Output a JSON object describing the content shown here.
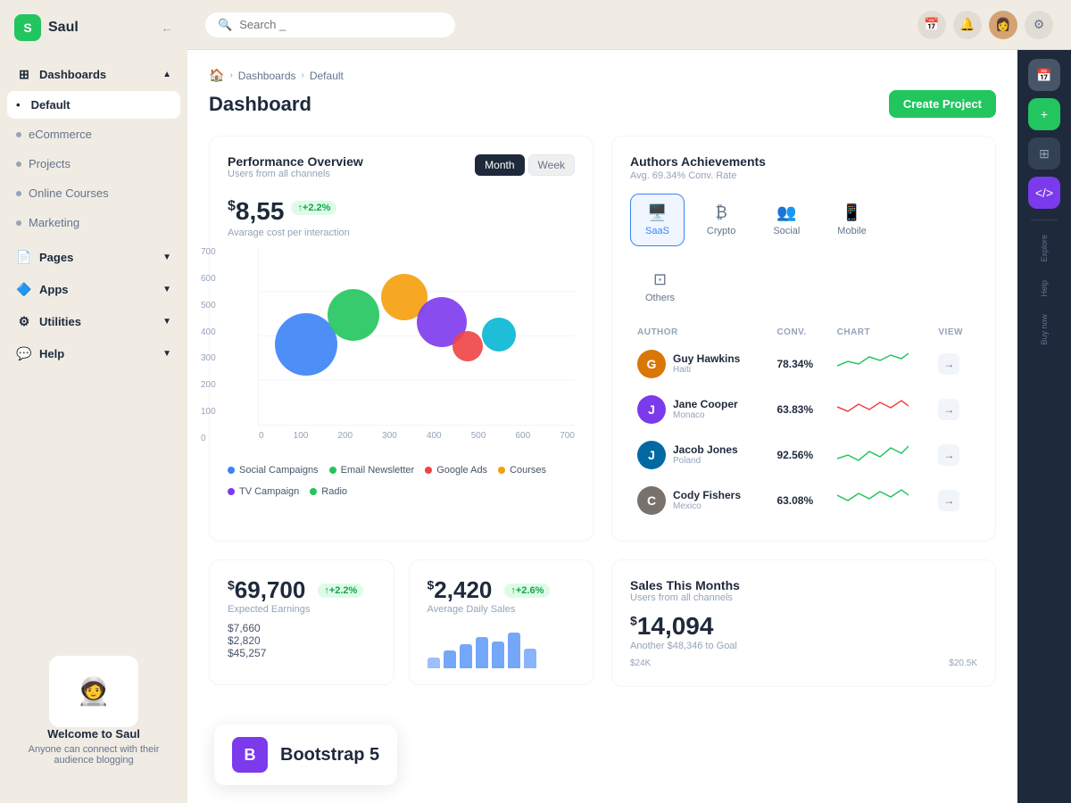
{
  "brand": {
    "icon": "S",
    "name": "Saul",
    "arrow": "←"
  },
  "search": {
    "placeholder": "Search _"
  },
  "sidebar": {
    "items": [
      {
        "id": "dashboards",
        "label": "Dashboards",
        "icon": "⊞",
        "hasChevron": true,
        "isHeader": true
      },
      {
        "id": "default",
        "label": "Default",
        "isActive": true
      },
      {
        "id": "ecommerce",
        "label": "eCommerce"
      },
      {
        "id": "projects",
        "label": "Projects"
      },
      {
        "id": "online-courses",
        "label": "Online Courses"
      },
      {
        "id": "marketing",
        "label": "Marketing"
      },
      {
        "id": "pages",
        "label": "Pages",
        "icon": "📄",
        "hasChevron": true,
        "isHeader": true
      },
      {
        "id": "apps",
        "label": "Apps",
        "icon": "🔷",
        "hasChevron": true,
        "isHeader": true
      },
      {
        "id": "utilities",
        "label": "Utilities",
        "icon": "⚙",
        "hasChevron": true,
        "isHeader": true
      },
      {
        "id": "help",
        "label": "Help",
        "icon": "💬",
        "hasChevron": true,
        "isHeader": true
      }
    ]
  },
  "sidebar_bottom": {
    "title": "Welcome to Saul",
    "subtitle": "Anyone can connect with their audience blogging",
    "emoji": "🧑‍🚀"
  },
  "breadcrumb": {
    "home": "🏠",
    "dashboards": "Dashboards",
    "current": "Default"
  },
  "page_title": "Dashboard",
  "create_btn": "Create Project",
  "performance": {
    "title": "Performance Overview",
    "subtitle": "Users from all channels",
    "tab_month": "Month",
    "tab_week": "Week",
    "value": "8,55",
    "currency": "$",
    "badge": "+2.2%",
    "label": "Avarage cost per interaction",
    "y_axis": [
      "700",
      "600",
      "500",
      "400",
      "300",
      "200",
      "100",
      "0"
    ],
    "x_axis": [
      "0",
      "100",
      "200",
      "300",
      "400",
      "500",
      "600",
      "700"
    ],
    "bubbles": [
      {
        "x": 18,
        "y": 48,
        "size": 70,
        "color": "#3b82f6"
      },
      {
        "x": 32,
        "y": 30,
        "size": 60,
        "color": "#22c55e"
      },
      {
        "x": 47,
        "y": 22,
        "size": 52,
        "color": "#f59e0b"
      },
      {
        "x": 58,
        "y": 35,
        "size": 55,
        "color": "#7c3aed"
      },
      {
        "x": 64,
        "y": 48,
        "size": 32,
        "color": "#ef4444"
      },
      {
        "x": 74,
        "y": 42,
        "size": 38,
        "color": "#06b6d4"
      }
    ],
    "legend": [
      {
        "label": "Social Campaigns",
        "color": "#3b82f6"
      },
      {
        "label": "Email Newsletter",
        "color": "#22c55e"
      },
      {
        "label": "Google Ads",
        "color": "#ef4444"
      },
      {
        "label": "Courses",
        "color": "#f59e0b"
      },
      {
        "label": "TV Campaign",
        "color": "#7c3aed"
      },
      {
        "label": "Radio",
        "color": "#22c55e"
      }
    ]
  },
  "authors": {
    "title": "Authors Achievements",
    "subtitle": "Avg. 69.34% Conv. Rate",
    "categories": [
      {
        "id": "saas",
        "label": "SaaS",
        "icon": "🖥️",
        "active": true
      },
      {
        "id": "crypto",
        "label": "Crypto",
        "icon": "₿"
      },
      {
        "id": "social",
        "label": "Social",
        "icon": "👥"
      },
      {
        "id": "mobile",
        "label": "Mobile",
        "icon": "📱"
      },
      {
        "id": "others",
        "label": "Others",
        "icon": "⊡"
      }
    ],
    "cols": {
      "author": "AUTHOR",
      "conv": "CONV.",
      "chart": "CHART",
      "view": "VIEW"
    },
    "rows": [
      {
        "name": "Guy Hawkins",
        "country": "Haiti",
        "conv": "78.34%",
        "color": "#d97706",
        "initials": "G"
      },
      {
        "name": "Jane Cooper",
        "country": "Monaco",
        "conv": "63.83%",
        "color": "#7c3aed",
        "initials": "J"
      },
      {
        "name": "Jacob Jones",
        "country": "Poland",
        "conv": "92.56%",
        "color": "#0369a1",
        "initials": "J"
      },
      {
        "name": "Cody Fishers",
        "country": "Mexico",
        "conv": "63.08%",
        "color": "#78716c",
        "initials": "C"
      }
    ]
  },
  "stats": {
    "earnings": {
      "value": "69,700",
      "badge": "+2.2%",
      "label": "Expected Earnings",
      "amounts": [
        "$7,660",
        "$2,820",
        "$45,257"
      ],
      "bars": [
        20,
        30,
        45,
        35,
        42,
        38,
        50
      ]
    },
    "daily_sales": {
      "value": "2,420",
      "badge": "+2.6%",
      "label": "Average Daily Sales"
    }
  },
  "sales": {
    "title": "Sales This Months",
    "subtitle": "Users from all channels",
    "value": "14,094",
    "currency": "$",
    "goal_label": "Another $48,346 to Goal",
    "y_labels": [
      "$24K",
      "$20.5K"
    ]
  },
  "right_sidebar": {
    "explore": "Explore",
    "help": "Help",
    "buy": "Buy now"
  },
  "bootstrap_overlay": {
    "icon": "B",
    "text": "Bootstrap 5"
  }
}
